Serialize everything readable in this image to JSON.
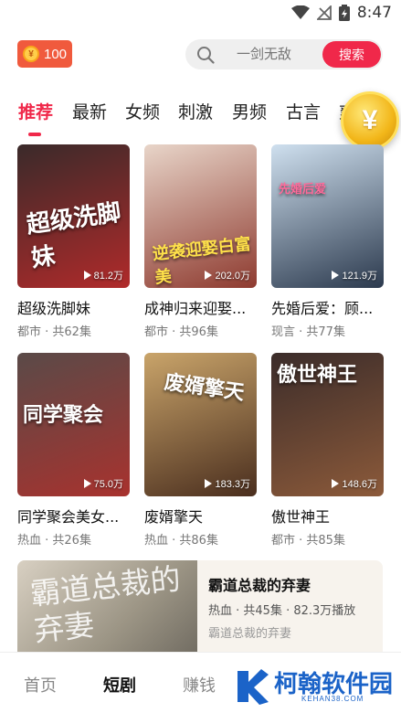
{
  "status_bar": {
    "time": "8:47"
  },
  "header": {
    "coin_count": "100",
    "coin_symbol": "¥",
    "search_placeholder": "一剑无敌",
    "search_button": "搜索"
  },
  "tabs": [
    "推荐",
    "最新",
    "女频",
    "刺激",
    "男频",
    "古言",
    "爽"
  ],
  "floating_coin_symbol": "¥",
  "dramas": [
    {
      "title": "超级洗脚妹",
      "meta": "都市 · 共62集",
      "plays": "81.2万",
      "poster_text": "超级洗脚妹",
      "colors": [
        "#3a2a2a",
        "#b02a2a"
      ]
    },
    {
      "title": "成神归来迎娶...",
      "meta": "都市 · 共96集",
      "plays": "202.0万",
      "poster_text": "逆袭迎娶白富美",
      "colors": [
        "#e8d5c9",
        "#8e3a2f"
      ]
    },
    {
      "title": "先婚后爱：顾...",
      "meta": "现言 · 共77集",
      "plays": "121.9万",
      "poster_text": "先婚后爱",
      "colors": [
        "#cfe0ef",
        "#2c3a4e"
      ]
    },
    {
      "title": "同学聚会美女...",
      "meta": "热血 · 共26集",
      "plays": "75.0万",
      "poster_text": "同学聚会",
      "colors": [
        "#5a4a48",
        "#a8322e"
      ]
    },
    {
      "title": "废婿擎天",
      "meta": "热血 · 共86集",
      "plays": "183.3万",
      "poster_text": "废婿擎天",
      "colors": [
        "#c9a46a",
        "#4a2e1e"
      ]
    },
    {
      "title": "傲世神王",
      "meta": "都市 · 共85集",
      "plays": "148.6万",
      "poster_text": "傲世神王",
      "colors": [
        "#3b2c2a",
        "#8c5a3a"
      ]
    }
  ],
  "featured": {
    "title": "霸道总裁的弃妻",
    "meta": "热血 · 共45集 · 82.3万播放",
    "description": "霸道总裁的弃妻",
    "poster_text": "霸道总裁的弃妻"
  },
  "bottom_nav": [
    "首页",
    "短剧",
    "赚钱"
  ],
  "watermark": {
    "name": "柯翰软件园",
    "url": "KEHAN38.COM"
  }
}
